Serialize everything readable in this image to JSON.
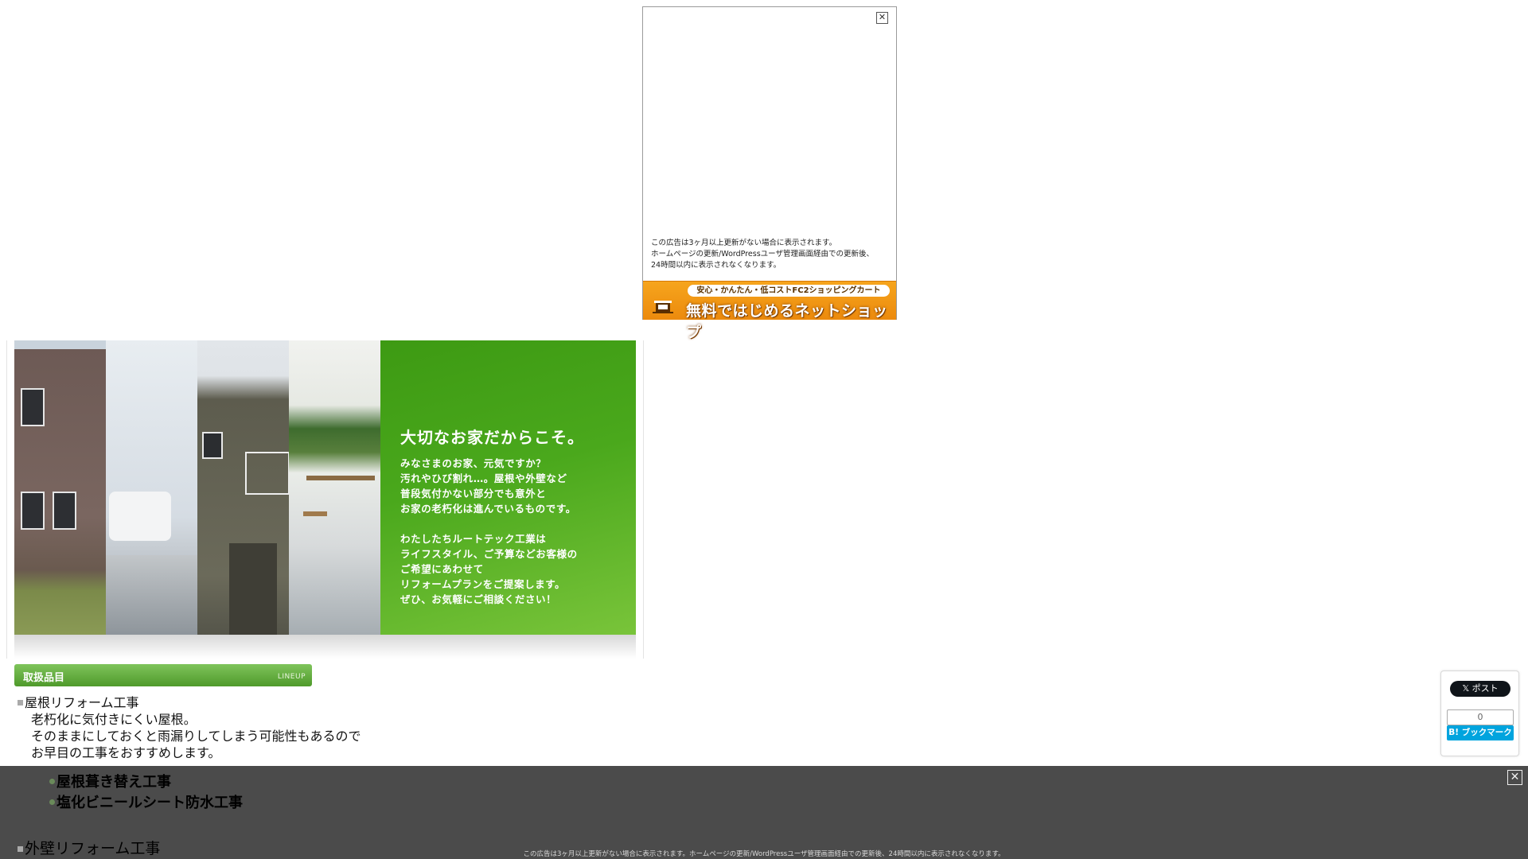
{
  "top_ad": {
    "close_glyph": "✕",
    "notice_lines": [
      "この広告は3ヶ月以上更新がない場合に表示されます。",
      "ホームページの更新/WordPressユーザ管理画面経由での更新後、",
      "24時間以内に表示されなくなります。"
    ],
    "banner_top": "安心・かんたん・低コストFC2ショッピングカート",
    "banner_main": "無料ではじめるネットショップ"
  },
  "hero": {
    "headline": "大切なお家だからこそ。",
    "lines": [
      "みなさまのお家、元気ですか？",
      "汚れやひび割れ…。屋根や外壁など",
      "普段気付かない部分でも意外と",
      "お家の老朽化は進んでいるものです。",
      "",
      "わたしたちルートテック工業は",
      "ライフスタイル、ご予算などお客様の",
      "ご希望にあわせて",
      "リフォームプランをご提案します。",
      "ぜひ、お気軽にご相談ください！"
    ]
  },
  "lineup": {
    "title": "取扱品目",
    "subtitle": "LINEUP"
  },
  "content": {
    "category1": "屋根リフォーム工事",
    "category1_desc": [
      "老朽化に気付きにくい屋根。",
      "そのままにしておくと雨漏りしてしまう可能性もあるので",
      "お早目の工事をおすすめします。"
    ],
    "sub_items": [
      "屋根葺き替え工事",
      "塩化ビニールシート防水工事"
    ],
    "category2": "外壁リフォーム工事"
  },
  "social": {
    "x_post": "𝕏 ポスト",
    "hatena_count": "0",
    "hatena_label": "B! ブックマーク"
  },
  "bottom_overlay": {
    "close_glyph": "✕",
    "notice": "この広告は3ヶ月以上更新がない場合に表示されます。ホームページの更新/WordPressユーザ管理画面経由での更新後、24時間以内に表示されなくなります。"
  },
  "colors": {
    "hero_green": "#4aa81c",
    "ad_orange": "#f19a17",
    "overlay_gray": "#4b4b4b",
    "hatena_blue": "#00a4de"
  }
}
